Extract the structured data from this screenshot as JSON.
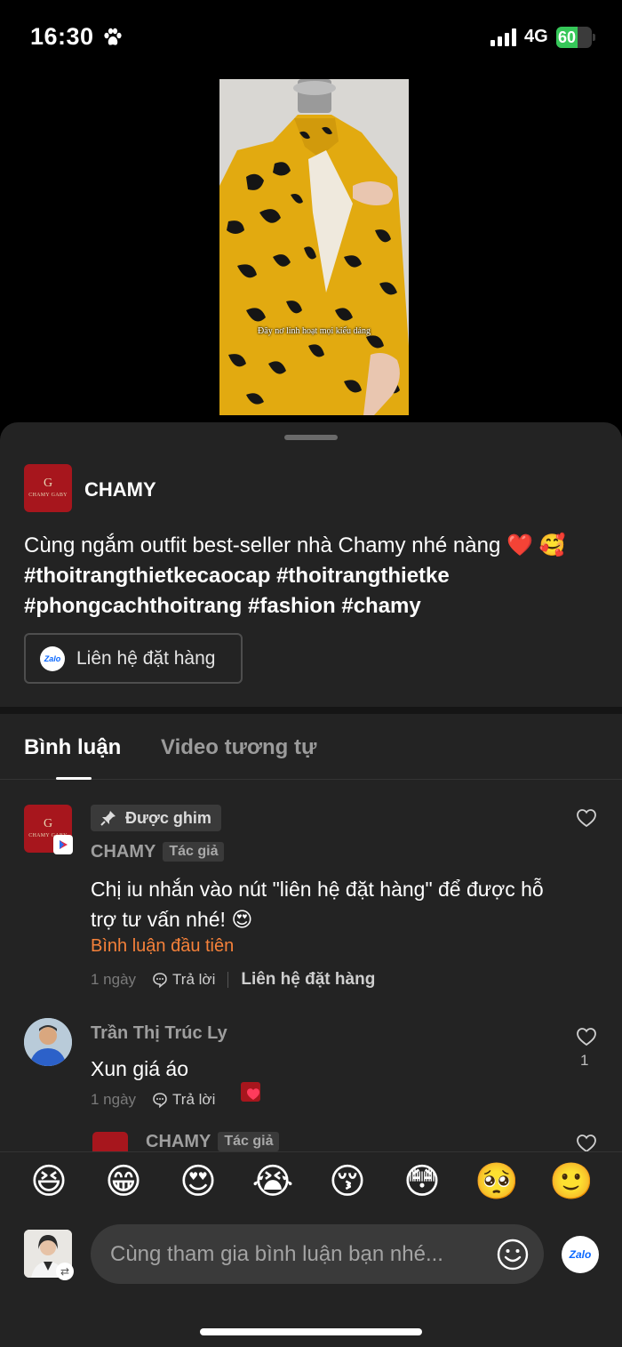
{
  "status_bar": {
    "time": "16:30",
    "network": "4G",
    "battery_level": "60",
    "battery_fill_percent": 60,
    "icons": [
      "paw-icon",
      "signal-icon",
      "battery-charging-icon"
    ]
  },
  "video": {
    "subtitle": "Đây nơ linh hoạt mọi kiểu dáng"
  },
  "post": {
    "author_logo_mark": "G",
    "author_logo_text": "CHAMY GABY",
    "author_name": "CHAMY",
    "caption_text": "Cùng ngắm outfit best-seller nhà Chamy nhé nàng ",
    "caption_heart": "❤️",
    "caption_emoji": "🥰",
    "caption_tags": " #thoitrangthietkecaocap #thoitrangthietke #phongcachthoitrang #fashion #chamy",
    "contact_button_label": "Liên hệ đặt hàng",
    "zalo_icon_text": "Zalo"
  },
  "tabs": [
    {
      "label": "Bình luận",
      "active": true
    },
    {
      "label": "Video tương tự",
      "active": false
    }
  ],
  "comments": [
    {
      "pinned_label": "Được ghim",
      "name": "CHAMY",
      "author_tag": "Tác giả",
      "text": "Chị iu nhắn vào nút \"liên hệ đặt hàng\" để được hỗ trợ tư vấn nhé! 😍",
      "first_comment": "Bình luận đầu tiên",
      "time": "1 ngày",
      "reply": "Trả lời",
      "contact_link": "Liên hệ đặt hàng"
    },
    {
      "name": "Trần Thị Trúc Ly",
      "text": "Xun giá  áo",
      "time": "1 ngày",
      "reply": "Trả lời",
      "like_count": "1"
    },
    {
      "name": "CHAMY",
      "author_tag": "Tác giả"
    }
  ],
  "emoji_bar": [
    "😆",
    "😁",
    "😍",
    "😭",
    "😚",
    "😳",
    "🥺",
    "🙂"
  ],
  "input": {
    "placeholder": "Cùng tham gia bình luận bạn nhé...",
    "zalo_text": "Zalo"
  },
  "colors": {
    "sheet_bg": "#232323",
    "accent_orange": "#f5813a",
    "brand_red": "#a7161d",
    "battery_green": "#36c759"
  }
}
